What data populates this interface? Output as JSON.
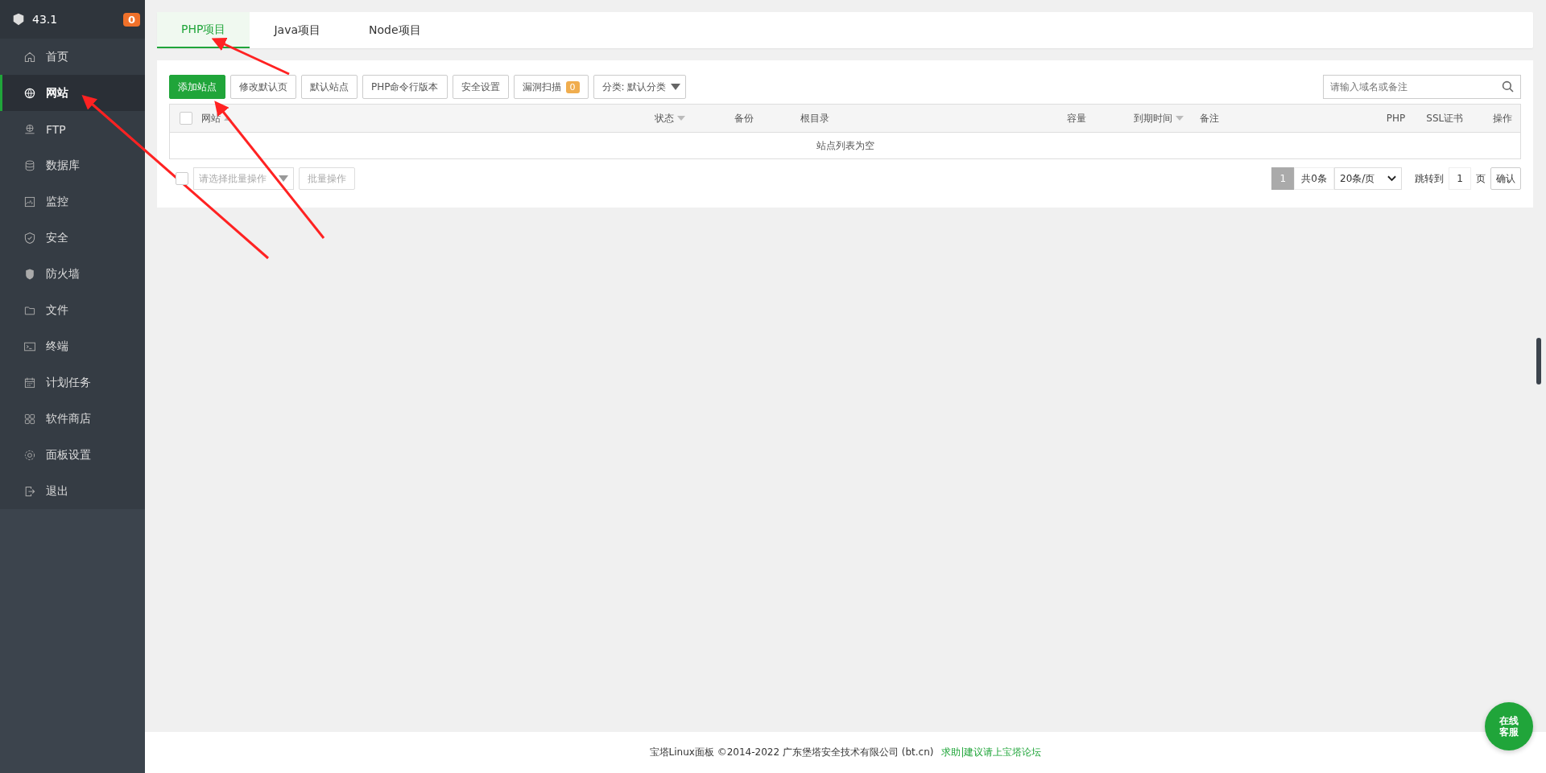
{
  "sidebar": {
    "server": "43.1",
    "badge": "0",
    "items": [
      {
        "label": "首页",
        "selected": false
      },
      {
        "label": "网站",
        "selected": true
      },
      {
        "label": "FTP",
        "selected": false
      },
      {
        "label": "数据库",
        "selected": false
      },
      {
        "label": "监控",
        "selected": false
      },
      {
        "label": "安全",
        "selected": false
      },
      {
        "label": "防火墙",
        "selected": false
      },
      {
        "label": "文件",
        "selected": false
      },
      {
        "label": "终端",
        "selected": false
      },
      {
        "label": "计划任务",
        "selected": false
      },
      {
        "label": "软件商店",
        "selected": false
      },
      {
        "label": "面板设置",
        "selected": false
      },
      {
        "label": "退出",
        "selected": false
      }
    ]
  },
  "tabs": [
    {
      "label": "PHP项目",
      "selected": true
    },
    {
      "label": "Java项目",
      "selected": false
    },
    {
      "label": "Node项目",
      "selected": false
    }
  ],
  "toolbar": {
    "buttons": [
      {
        "label": "添加站点",
        "kind": "primary"
      },
      {
        "label": "修改默认页",
        "kind": "plain"
      },
      {
        "label": "默认站点",
        "kind": "plain"
      },
      {
        "label": "PHP命令行版本",
        "kind": "plain"
      },
      {
        "label": "安全设置",
        "kind": "plain"
      },
      {
        "label": "漏洞扫描",
        "kind": "badge",
        "badge": "0"
      },
      {
        "label": "分类: 默认分类",
        "kind": "select"
      }
    ],
    "search": {
      "placeholder": "请输入域名或备注"
    }
  },
  "table": {
    "select_all_checked": false,
    "columns": [
      {
        "label": "网站",
        "sortable": true
      },
      {
        "label": "状态",
        "sortable": true
      },
      {
        "label": "备份",
        "sortable": false
      },
      {
        "label": "根目录",
        "sortable": false
      },
      {
        "label": "容量",
        "sortable": false
      },
      {
        "label": "到期时间",
        "sortable": true
      },
      {
        "label": "备注",
        "sortable": false
      },
      {
        "label": "PHP",
        "sortable": false
      },
      {
        "label": "SSL证书",
        "sortable": false
      },
      {
        "label": "操作",
        "sortable": false
      }
    ],
    "empty": "站点列表为空"
  },
  "batch": {
    "checked": false,
    "placeholder": "请选择批量操作",
    "button": "批量操作"
  },
  "pagination": {
    "page": "1",
    "total": "共0条",
    "per_page": "20条/页",
    "jump_label": "跳转到",
    "jump_value": "1",
    "page_unit": "页",
    "confirm": "确认"
  },
  "footer": {
    "copyright": "宝塔Linux面板 ©2014-2022 广东堡塔安全技术有限公司 (bt.cn)",
    "link": "求助|建议请上宝塔论坛"
  },
  "chat_button": {
    "line1": "在线",
    "line2": "客服"
  }
}
